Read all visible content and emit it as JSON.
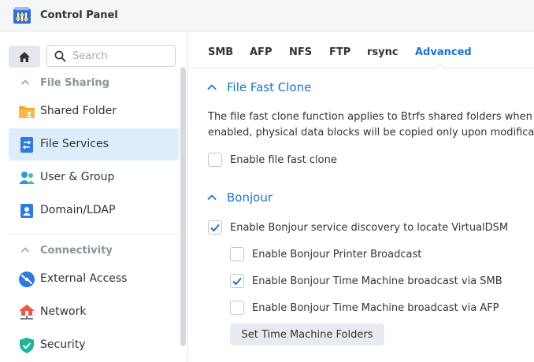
{
  "window": {
    "title": "Control Panel"
  },
  "sidebar": {
    "search_placeholder": "Search",
    "groups": [
      {
        "label": "File Sharing"
      },
      {
        "label": "Connectivity"
      }
    ],
    "items": [
      {
        "label": "Shared Folder",
        "icon": "folder-icon"
      },
      {
        "label": "File Services",
        "icon": "file-services-icon",
        "active": true
      },
      {
        "label": "User & Group",
        "icon": "users-icon"
      },
      {
        "label": "Domain/LDAP",
        "icon": "domain-icon"
      },
      {
        "label": "External Access",
        "icon": "external-access-icon"
      },
      {
        "label": "Network",
        "icon": "network-icon"
      },
      {
        "label": "Security",
        "icon": "shield-icon"
      }
    ]
  },
  "tabs": [
    {
      "label": "SMB"
    },
    {
      "label": "AFP"
    },
    {
      "label": "NFS"
    },
    {
      "label": "FTP"
    },
    {
      "label": "rsync"
    },
    {
      "label": "Advanced",
      "active": true
    }
  ],
  "file_fast_clone": {
    "title": "File Fast Clone",
    "desc_line1": "The file fast clone function applies to Btrfs shared folders when",
    "desc_line2": "enabled, physical data blocks will be copied only upon modifica",
    "enable_label": "Enable file fast clone",
    "enabled": false
  },
  "bonjour": {
    "title": "Bonjour",
    "service_discovery_label": "Enable Bonjour service discovery to locate VirtualDSM",
    "printer_broadcast_label": "Enable Bonjour Printer Broadcast",
    "tm_smb_label": "Enable Bonjour Time Machine broadcast via SMB",
    "tm_afp_label": "Enable Bonjour Time Machine broadcast via AFP",
    "set_tm_button": "Set Time Machine Folders"
  },
  "colors": {
    "accent": "#1a73c8",
    "active_bg": "#deedfb"
  }
}
